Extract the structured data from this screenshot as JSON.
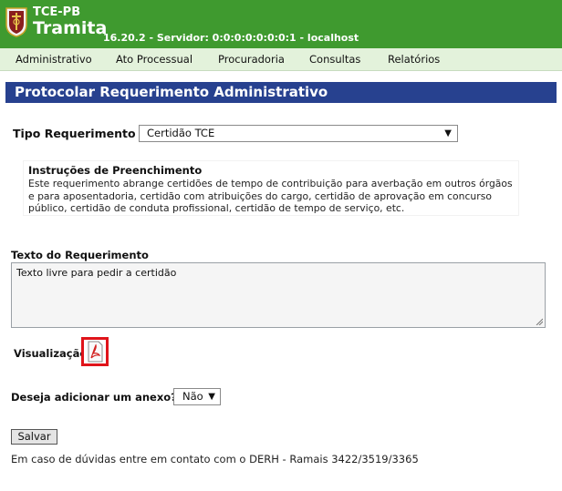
{
  "header": {
    "brand_top": "TCE-PB",
    "brand_main": "Tramita",
    "server_info": "16.20.2 - Servidor: 0:0:0:0:0:0:0:1 - localhost",
    "logo_icon": "tce-shield-logo-icon",
    "bg_color": "#3f9a2f"
  },
  "menu": {
    "items": [
      {
        "label": "Administrativo"
      },
      {
        "label": "Ato Processual"
      },
      {
        "label": "Procuradoria"
      },
      {
        "label": "Consultas"
      },
      {
        "label": "Relatórios"
      }
    ]
  },
  "page": {
    "title": "Protocolar Requerimento Administrativo",
    "title_bg": "#27418f"
  },
  "form": {
    "tipo_label": "Tipo Requerimento",
    "tipo_value": "Certidão TCE",
    "instructions_title": "Instruções de Preenchimento",
    "instructions_text": "Este requerimento abrange certidões de tempo de contribuição para averbação em outros órgãos e para aposentadoria, certidão com atribuições do cargo, certidão de aprovação em concurso público, certidão de conduta profissional, certidão de tempo de serviço, etc.",
    "texto_label": "Texto do Requerimento",
    "texto_value": "Texto livre para pedir a certidão",
    "visualizacao_label": "Visualização",
    "visualizacao_icon": "pdf-icon",
    "anexo_label": "Deseja adicionar um anexo?",
    "anexo_value": "Não",
    "save_label": "Salvar",
    "contact_text": "Em caso de dúvidas entre em contato com o DERH - Ramais 3422/3519/3365"
  }
}
